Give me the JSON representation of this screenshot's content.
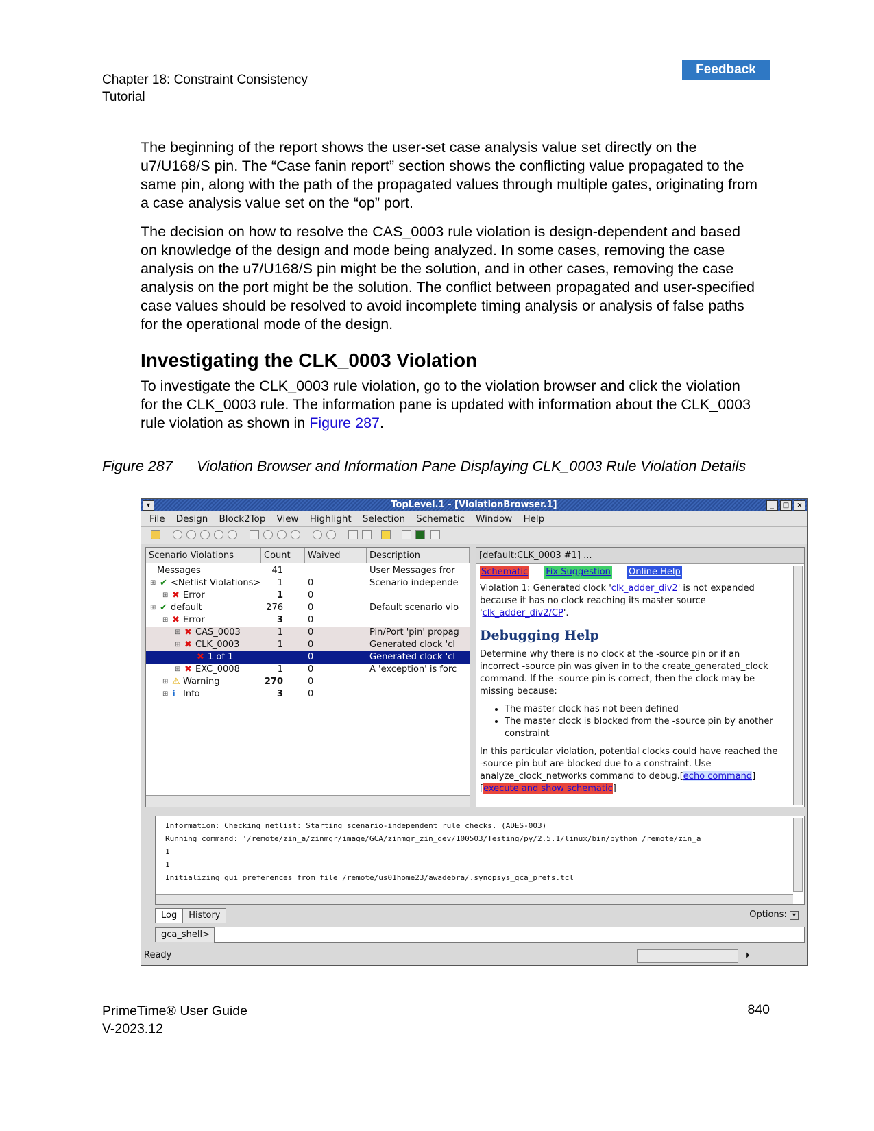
{
  "header": {
    "chapter": "Chapter 18: Constraint Consistency",
    "section": "Tutorial",
    "feedback": "Feedback"
  },
  "paragraphs": [
    "The beginning of the report shows the user-set case analysis value set directly on the u7/U168/S pin. The “Case fanin report” section shows the conflicting value propagated to the same pin, along with the path of the propagated values through multiple gates, originating from a case analysis value set on the “op” port.",
    "The decision on how to resolve the CAS_0003 rule violation is design-dependent and based on knowledge of the design and mode being analyzed. In some cases, removing the case analysis on the u7/U168/S pin might be the solution, and in other cases, removing the case analysis on the port might be the solution. The conflict between propagated and user-specified case values should be resolved to avoid incomplete timing analysis or analysis of false paths for the operational mode of the design."
  ],
  "heading": "Investigating the CLK_0003 Violation",
  "para3_before": "To investigate the CLK_0003 rule violation, go to the violation browser and click the violation for the CLK_0003 rule. The information pane is updated with information about the CLK_0003 rule violation as shown in ",
  "para3_link": "Figure 287",
  "para3_after": ".",
  "caption": {
    "num": "Figure 287",
    "text": "Violation Browser and Information Pane Displaying CLK_0003 Rule Violation Details"
  },
  "window": {
    "title": "TopLevel.1 - [ViolationBrowser.1]",
    "menu": [
      "File",
      "Design",
      "Block2Top",
      "View",
      "Highlight",
      "Selection",
      "Schematic",
      "Window",
      "Help"
    ],
    "columns": [
      "Scenario Violations",
      "Count",
      "Waived",
      "Description"
    ],
    "rows": [
      {
        "indent": 0,
        "icon": "",
        "name": "Messages",
        "count": "41",
        "waived": "",
        "desc": "User Messages fror"
      },
      {
        "indent": 0,
        "icon": "✔",
        "name": "<Netlist Violations>",
        "count": "1",
        "waived": "0",
        "desc": "Scenario independe"
      },
      {
        "indent": 1,
        "icon": "✖",
        "name": "Error",
        "count": "1",
        "waived": "0",
        "desc": ""
      },
      {
        "indent": 0,
        "icon": "✔",
        "name": "default",
        "count": "276",
        "waived": "0",
        "desc": "Default scenario vio"
      },
      {
        "indent": 1,
        "icon": "✖",
        "name": "Error",
        "count": "3",
        "waived": "0",
        "desc": ""
      },
      {
        "indent": 2,
        "icon": "✖",
        "name": "CAS_0003",
        "count": "1",
        "waived": "0",
        "desc": "Pin/Port 'pin' propag"
      },
      {
        "indent": 2,
        "icon": "✖",
        "name": "CLK_0003",
        "count": "1",
        "waived": "0",
        "desc": "Generated clock 'cl"
      },
      {
        "indent": 3,
        "icon": "✖",
        "name": "1 of 1",
        "count": "",
        "waived": "0",
        "desc": "Generated clock 'cl"
      },
      {
        "indent": 2,
        "icon": "✖",
        "name": "EXC_0008",
        "count": "1",
        "waived": "0",
        "desc": "A 'exception' is forc"
      },
      {
        "indent": 1,
        "icon": "⚠",
        "name": "Warning",
        "count": "270",
        "waived": "0",
        "desc": ""
      },
      {
        "indent": 1,
        "icon": "ℹ",
        "name": "Info",
        "count": "3",
        "waived": "0",
        "desc": ""
      }
    ],
    "info_header": "[default:CLK_0003 #1] ...",
    "info_links": [
      "Schematic",
      "Fix Suggestion",
      "Online Help"
    ],
    "violation_text_1": "Violation 1: Generated clock '",
    "violation_link_1": "clk_adder_div2",
    "violation_text_2": "' is not expanded because it has no clock reaching its master source '",
    "violation_link_2": "clk_adder_div2/CP",
    "violation_text_3": "'.",
    "debug_title": "Debugging Help",
    "debug_text": "Determine why there is no clock at the -source pin or if an incorrect -source pin was given in to the create_generated_clock command. If the -source pin is correct, then the clock may be missing because:",
    "bullets": [
      "The master clock has not been defined",
      "The master clock is blocked from the -source pin by another constraint"
    ],
    "closing_text": "In this particular violation, potential clocks could have reached the -source pin but are blocked due to a constraint. Use analyze_clock_networks command to debug.[",
    "closing_link_1": "echo command",
    "closing_mid": "] [",
    "closing_link_2": "execute and show schematic",
    "closing_end": "]",
    "log_lines": [
      "Information: Checking netlist: Starting scenario-independent rule checks. (ADES-003)",
      "Running command: '/remote/zin_a/zinmgr/image/GCA/zinmgr_zin_dev/100503/Testing/py/2.5.1/linux/bin/python /remote/zin_a",
      "1",
      "1",
      "Initializing gui preferences from file  /remote/us01home23/awadebra/.synopsys_gca_prefs.tcl"
    ],
    "tabs": [
      "Log",
      "History"
    ],
    "options": "Options:",
    "prompt": "gca_shell>",
    "status": "Ready"
  },
  "footer": {
    "title": "PrimeTime® User Guide",
    "version": "V-2023.12",
    "page": "840"
  }
}
